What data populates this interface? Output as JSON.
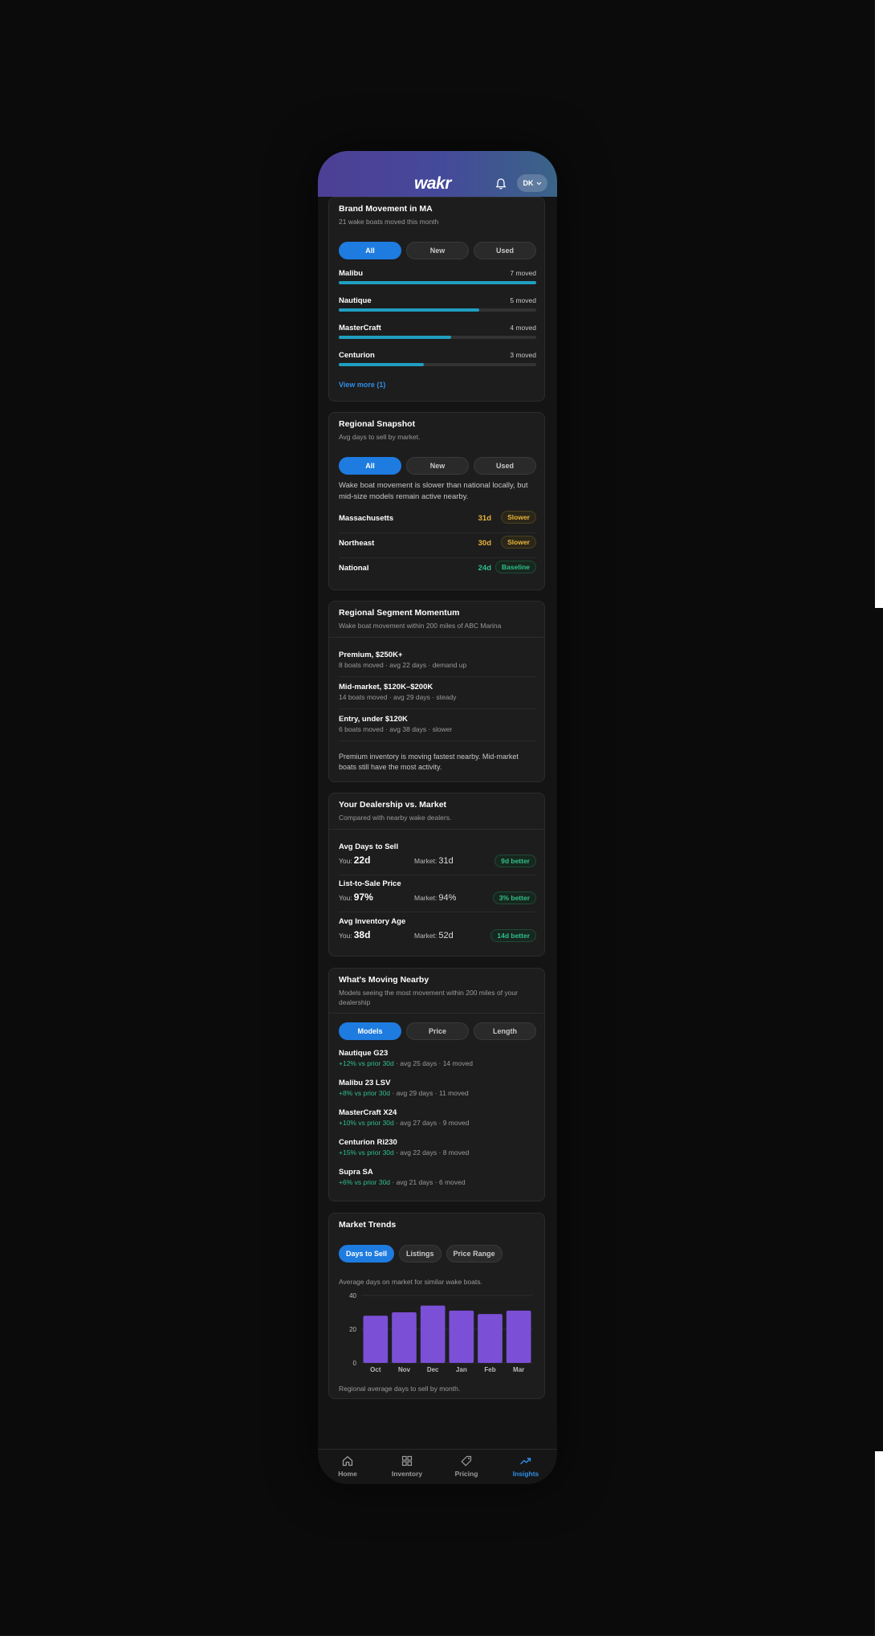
{
  "app": {
    "logo": "wakr",
    "avatar_initials": "DK"
  },
  "brand_movement": {
    "title": "Brand Movement in MA",
    "subtitle": "21 wake boats moved this month",
    "filters": [
      "All",
      "New",
      "Used"
    ],
    "active_filter": "All",
    "brands": [
      {
        "name": "Malibu",
        "count_label": "7 moved",
        "share": 1.0
      },
      {
        "name": "Nautique",
        "count_label": "5 moved",
        "share": 0.71
      },
      {
        "name": "MasterCraft",
        "count_label": "4 moved",
        "share": 0.57
      },
      {
        "name": "Centurion",
        "count_label": "3 moved",
        "share": 0.43
      }
    ],
    "view_more": "View more (1)"
  },
  "regional_snapshot": {
    "title": "Regional Snapshot",
    "subtitle": "Avg days to sell by market.",
    "filters": [
      "All",
      "New",
      "Used"
    ],
    "active_filter": "All",
    "summary": "Wake boat movement is slower than national locally, but mid-size models remain active nearby.",
    "regions": [
      {
        "name": "Massachusetts",
        "days": "31d",
        "status": "Slower"
      },
      {
        "name": "Northeast",
        "days": "30d",
        "status": "Slower"
      },
      {
        "name": "National",
        "days": "24d",
        "status": "Baseline"
      }
    ],
    "colors": {
      "slower": "#e9b43a",
      "baseline": "#2fbf8a"
    }
  },
  "segment_momentum": {
    "title": "Regional Segment Momentum",
    "subtitle": "Wake boat movement within 200 miles of ABC Marina",
    "segments": [
      {
        "name": "Premium, $250K+",
        "detail": "8 boats moved · avg 22 days · demand up"
      },
      {
        "name": "Mid-market, $120K–$200K",
        "detail": "14 boats moved · avg 29 days · steady"
      },
      {
        "name": "Entry, under $120K",
        "detail": "6 boats moved · avg 38 days · slower"
      }
    ],
    "note": "Premium inventory is moving fastest nearby. Mid-market boats still have the most activity."
  },
  "dealership_vs_market": {
    "title": "Your Dealership vs. Market",
    "subtitle": "Compared with nearby wake dealers.",
    "you_label": "You:",
    "market_label": "Market:",
    "metrics": [
      {
        "label": "Avg Days to Sell",
        "you": "22d",
        "market": "31d",
        "badge": "9d better"
      },
      {
        "label": "List-to-Sale Price",
        "you": "97%",
        "market": "94%",
        "badge": "3% better"
      },
      {
        "label": "Avg Inventory Age",
        "you": "38d",
        "market": "52d",
        "badge": "14d better"
      }
    ]
  },
  "moving_nearby": {
    "title": "What's Moving Nearby",
    "subtitle": "Models seeing the most movement within 200 miles of your dealership",
    "filters": [
      "Models",
      "Price",
      "Length"
    ],
    "active_filter": "Models",
    "models": [
      {
        "name": "Nautique G23",
        "change": "+12% vs prior 30d",
        "rest": " · avg 25 days · 14 moved"
      },
      {
        "name": "Malibu 23 LSV",
        "change": "+8% vs prior 30d",
        "rest": " · avg 29 days · 11 moved"
      },
      {
        "name": "MasterCraft X24",
        "change": "+10% vs prior 30d",
        "rest": " · avg 27 days · 9 moved"
      },
      {
        "name": "Centurion Ri230",
        "change": "+15% vs prior 30d",
        "rest": " · avg 22 days · 8 moved"
      },
      {
        "name": "Supra SA",
        "change": "+6% vs prior 30d",
        "rest": " · avg 21 days · 6 moved"
      }
    ]
  },
  "market_trends": {
    "title": "Market Trends",
    "tabs": [
      "Days to Sell",
      "Listings",
      "Price Range"
    ],
    "active_tab": "Days to Sell",
    "caption": "Average days on market for similar wake boats.",
    "footnote": "Regional average days to sell by month.",
    "bar_color": "#7b4fd6"
  },
  "chart_data": {
    "type": "bar",
    "categories": [
      "Oct",
      "Nov",
      "Dec",
      "Jan",
      "Feb",
      "Mar"
    ],
    "values": [
      28,
      30,
      34,
      31,
      29,
      31
    ],
    "ylim": [
      0,
      40
    ],
    "yticks": [
      0,
      20,
      40
    ],
    "title": "",
    "xlabel": "",
    "ylabel": "",
    "grid": true
  },
  "nav": {
    "items": [
      {
        "label": "Home",
        "icon": "home-icon"
      },
      {
        "label": "Inventory",
        "icon": "grid-icon"
      },
      {
        "label": "Pricing",
        "icon": "tag-icon"
      },
      {
        "label": "Insights",
        "icon": "trend-up-icon"
      }
    ],
    "active": "Insights"
  }
}
